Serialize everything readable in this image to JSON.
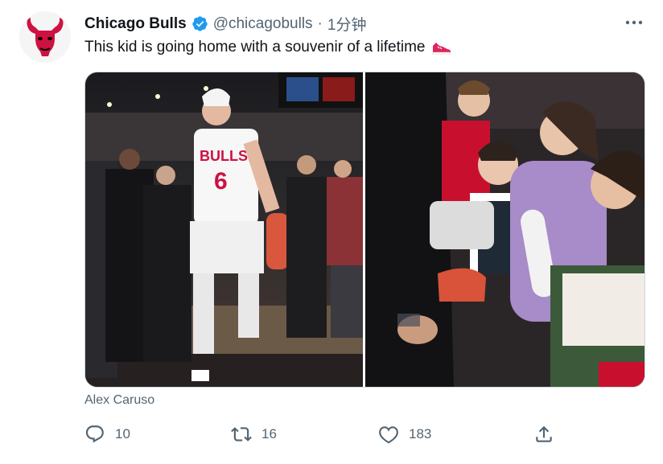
{
  "tweet": {
    "display_name": "Chicago Bulls",
    "handle": "@chicagobulls",
    "separator": "·",
    "timestamp": "1分钟",
    "text": "This kid is going home with a souvenir of a lifetime",
    "media_caption": "Alex Caruso",
    "player_jersey_name": "BULLS",
    "player_jersey_number": "6"
  },
  "counts": {
    "replies": "10",
    "retweets": "16",
    "likes": "183"
  },
  "colors": {
    "brand_red": "#ce1141",
    "verified_blue": "#1d9bf0",
    "muted_text": "#536471"
  },
  "icons": {
    "more": "more-icon",
    "verified": "verified-icon",
    "shoe_emoji": "sneaker-emoji",
    "reply": "reply-icon",
    "retweet": "retweet-icon",
    "like": "heart-icon",
    "share": "share-icon"
  }
}
